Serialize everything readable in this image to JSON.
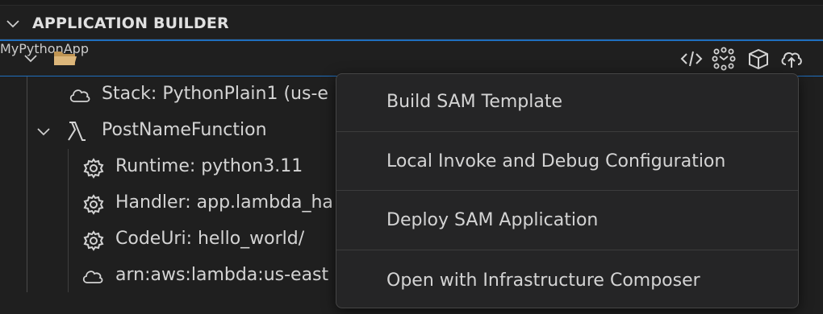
{
  "section": {
    "title": "APPLICATION BUILDER"
  },
  "tree": {
    "app": {
      "label": "MyPythonApp"
    },
    "stack": {
      "label": "Stack: PythonPlain1 (us-e"
    },
    "function": {
      "label": "PostNameFunction"
    },
    "runtime": {
      "label": "Runtime: python3.11"
    },
    "handler": {
      "label": "Handler: app.lambda_ha"
    },
    "codeuri": {
      "label": "CodeUri: hello_world/"
    },
    "arn": {
      "label": "arn:aws:lambda:us-east"
    }
  },
  "actions": [
    {
      "icon": "code-icon"
    },
    {
      "icon": "infrastructure-composer-icon"
    },
    {
      "icon": "package-icon"
    },
    {
      "icon": "cloud-upload-icon"
    }
  ],
  "context_menu": {
    "items": [
      {
        "label": "Build SAM Template"
      },
      {
        "label": "Local Invoke and Debug Configuration"
      },
      {
        "label": "Deploy SAM Application"
      },
      {
        "label": "Open with Infrastructure Composer"
      }
    ]
  },
  "colors": {
    "background": "#1f1f1f",
    "selection_border": "#1f6fbf",
    "menu_background": "#252526",
    "text": "#d4d4d4"
  }
}
